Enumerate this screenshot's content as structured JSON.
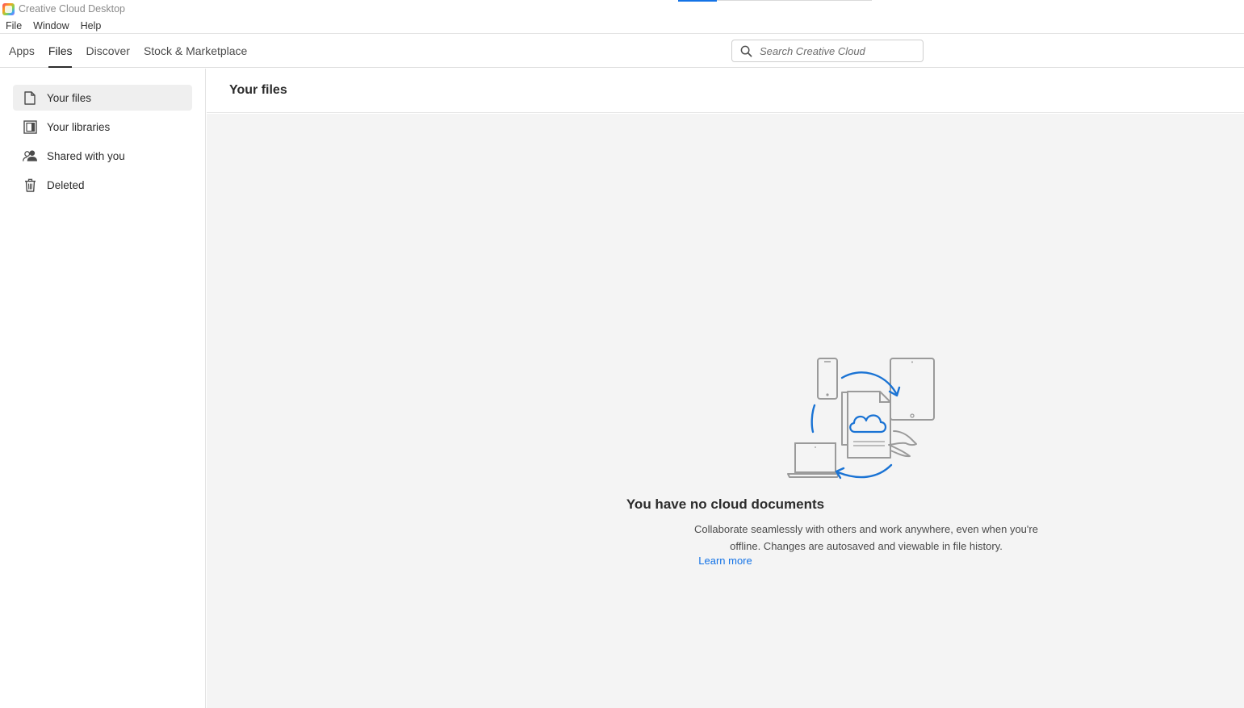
{
  "window": {
    "title": "Creative Cloud Desktop"
  },
  "menu": [
    "File",
    "Window",
    "Help"
  ],
  "nav": {
    "tabs": [
      {
        "label": "Apps"
      },
      {
        "label": "Files"
      },
      {
        "label": "Discover"
      },
      {
        "label": "Stock & Marketplace"
      }
    ],
    "active_tab": "Files"
  },
  "search": {
    "placeholder": "Search Creative Cloud",
    "value": ""
  },
  "sidebar": {
    "items": [
      {
        "label": "Your files",
        "icon": "document-icon"
      },
      {
        "label": "Your libraries",
        "icon": "libraries-icon"
      },
      {
        "label": "Shared with you",
        "icon": "people-icon"
      },
      {
        "label": "Deleted",
        "icon": "trash-icon"
      }
    ],
    "active": "Your files"
  },
  "main": {
    "header": "Your files",
    "empty_state": {
      "illustration": "cloud-sync-devices-illustration",
      "title": "You have no cloud documents",
      "description": "Collaborate seamlessly with others and work anywhere, even when you're offline. Changes are autosaved and viewable in file history.",
      "link": "Learn more"
    }
  },
  "colors": {
    "accent": "#1473e6",
    "content_bg": "#f4f4f4",
    "active_item_bg": "#efefef",
    "text": "#2c2c2c"
  }
}
